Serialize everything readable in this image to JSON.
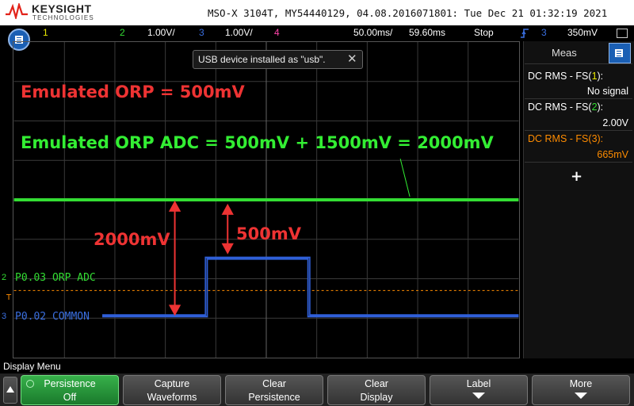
{
  "header": {
    "brand": "KEYSIGHT",
    "brand_sub": "TECHNOLOGIES",
    "title_line": "MSO-X 3104T, MY54440129, 04.08.2016071801: Tue Dec 21 01:32:19 2021"
  },
  "status": {
    "ch1_num": "1",
    "ch2_num": "2",
    "ch2_scale": "1.00V/",
    "ch3_num": "3",
    "ch3_scale": "1.00V/",
    "ch4_num": "4",
    "timebase": "50.00ms/",
    "delay": "59.60ms",
    "run_state": "Stop",
    "trig_channel": "3",
    "trig_level": "350mV"
  },
  "colors": {
    "ch1": "#e8e800",
    "ch2": "#33dd33",
    "ch3": "#3a6fe0",
    "ch4": "#ff44aa",
    "annotation_red": "#ee3333",
    "annotation_green": "#33ee33",
    "trigger_orange": "#ff8c00"
  },
  "usb_notice": {
    "text": "USB device installed as \"usb\".",
    "close_icon": "close-icon"
  },
  "annotations": {
    "orp": "Emulated ORP = 500mV",
    "orp_adc": "Emulated ORP ADC = 500mV + 1500mV = 2000mV",
    "delta_2000": "2000mV",
    "delta_500": "500mV"
  },
  "channel_labels": {
    "ch2_marker": "2",
    "ch2_label": "P0.03 ORP ADC",
    "ch3_marker": "3",
    "ch3_label": "P0.02 COMMON"
  },
  "meas": {
    "title": "Meas",
    "items": [
      {
        "prefix": "DC RMS - FS(",
        "channel": "1",
        "suffix": "):",
        "value": "No signal"
      },
      {
        "prefix": "DC RMS - FS(",
        "channel": "2",
        "suffix": "):",
        "value": "2.00V"
      },
      {
        "prefix": "DC RMS - FS(",
        "channel": "3",
        "suffix": "):",
        "value": "665mV"
      }
    ],
    "add_label": "+"
  },
  "softkeys": {
    "menu_title": "Display Menu",
    "keys": [
      {
        "line1": "Persistence",
        "line2": "Off"
      },
      {
        "line1": "Capture",
        "line2": "Waveforms"
      },
      {
        "line1": "Clear",
        "line2": "Persistence"
      },
      {
        "line1": "Clear",
        "line2": "Display"
      },
      {
        "line1": "Label",
        "line2": ""
      },
      {
        "line1": "More",
        "line2": ""
      }
    ]
  }
}
